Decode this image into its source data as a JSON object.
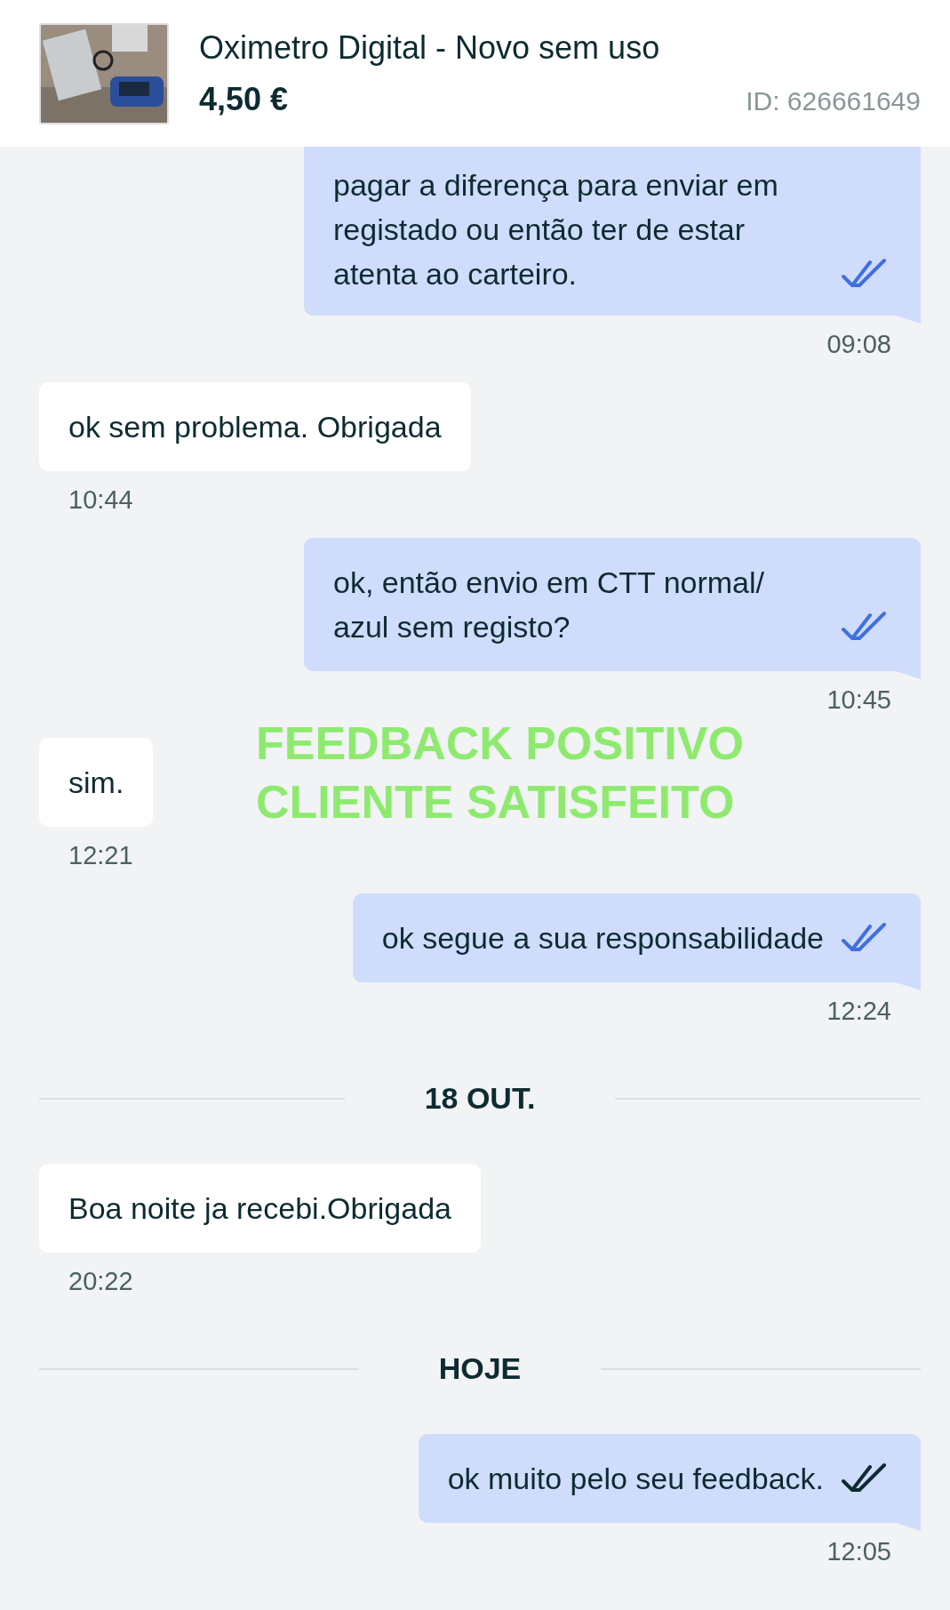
{
  "listing": {
    "title": "Oximetro Digital - Novo sem uso",
    "price": "4,50 €",
    "id": "ID: 626661649"
  },
  "messages": [
    {
      "kind": "message",
      "outgoing": true,
      "cut": true,
      "text": "pagar a diferença para enviar em registado ou então ter de estar atenta ao carteiro.",
      "read": true,
      "time": "09:08"
    },
    {
      "kind": "message",
      "outgoing": false,
      "text": "ok sem problema. Obrigada",
      "time": "10:44"
    },
    {
      "kind": "message",
      "outgoing": true,
      "text": "ok, então envio em CTT normal/ azul sem registo?",
      "read": true,
      "time": "10:45"
    },
    {
      "kind": "message",
      "outgoing": false,
      "text": "sim.",
      "time": "12:21"
    },
    {
      "kind": "message",
      "outgoing": true,
      "text": "ok segue a sua responsabilidade",
      "read": true,
      "time": "12:24"
    },
    {
      "kind": "date",
      "label": "18 OUT."
    },
    {
      "kind": "message",
      "outgoing": false,
      "text": "Boa noite ja recebi.Obrigada",
      "time": "20:22"
    },
    {
      "kind": "date",
      "label": "HOJE"
    },
    {
      "kind": "message",
      "outgoing": true,
      "text": "ok muito pelo seu feedback.",
      "read": false,
      "time": "12:05"
    }
  ],
  "overlay_text": [
    "FEEDBACK POSITIVO",
    "CLIENTE SATISFEITO"
  ]
}
